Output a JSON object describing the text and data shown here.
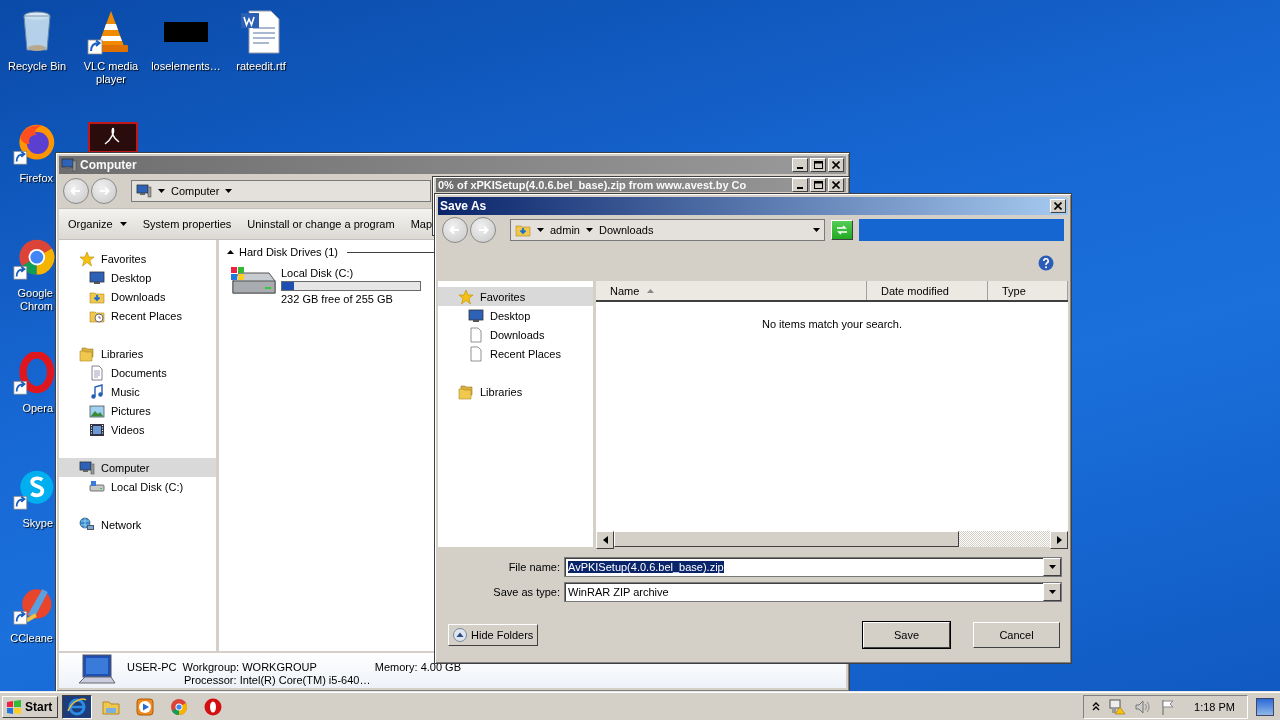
{
  "desktop": {
    "top_icons": [
      {
        "label": "Recycle Bin",
        "kind": "recycle"
      },
      {
        "label": "VLC media player",
        "kind": "vlc"
      },
      {
        "label": "loselements…",
        "kind": "thumbnail"
      },
      {
        "label": "rateedit.rtf",
        "kind": "word"
      }
    ],
    "side_icons": [
      {
        "label": "Firefox",
        "kind": "firefox"
      },
      {
        "label": "Google Chrom",
        "kind": "chrome"
      },
      {
        "label": "Opera",
        "kind": "opera"
      },
      {
        "label": "Skype",
        "kind": "skype"
      },
      {
        "label": "CCleane",
        "kind": "ccleaner"
      }
    ]
  },
  "computer_window": {
    "title": "Computer",
    "address": "Computer",
    "toolbar": [
      {
        "label": "Organize",
        "kind": "menu"
      },
      {
        "label": "System properties",
        "kind": "command"
      },
      {
        "label": "Uninstall or change a program",
        "kind": "command"
      },
      {
        "label": "Map",
        "kind": "command"
      }
    ],
    "nav": [
      {
        "label": "Favorites",
        "kind": "star",
        "selected": false,
        "children": [
          {
            "label": "Desktop",
            "kind": "monitor",
            "selected": false
          },
          {
            "label": "Downloads",
            "kind": "download-folder",
            "selected": false
          },
          {
            "label": "Recent Places",
            "kind": "clock-folder",
            "selected": false
          }
        ]
      },
      {
        "label": "Libraries",
        "kind": "library",
        "selected": false,
        "children": [
          {
            "label": "Documents",
            "kind": "document",
            "selected": false
          },
          {
            "label": "Music",
            "kind": "music",
            "selected": false
          },
          {
            "label": "Pictures",
            "kind": "picture",
            "selected": false
          },
          {
            "label": "Videos",
            "kind": "film",
            "selected": false
          }
        ]
      },
      {
        "label": "Computer",
        "kind": "computer",
        "selected": true,
        "children": [
          {
            "label": "Local Disk (C:)",
            "kind": "drive",
            "selected": false
          }
        ]
      },
      {
        "label": "Network",
        "kind": "network",
        "selected": false
      }
    ],
    "group": "Hard Disk Drives (1)",
    "drives": [
      {
        "name": "Local Disk (C:)",
        "level": 0.09,
        "space": "232 GB free of 255 GB"
      }
    ],
    "details": {
      "name": "USER-PC",
      "workgroup": "Workgroup: WORKGROUP",
      "memory": "Memory: 4.00 GB",
      "processor": "Processor: Intel(R) Core(TM) i5-640…"
    }
  },
  "download_window": {
    "title": "0% of xPKISetup(4.0.6.bel_base).zip from www.avest.by Co"
  },
  "save_dialog": {
    "title": "Save As",
    "path": [
      "admin",
      "Downloads"
    ],
    "nav": [
      {
        "label": "Favorites",
        "kind": "star",
        "selected": true,
        "children": [
          {
            "label": "Desktop",
            "kind": "monitor",
            "selected": false
          },
          {
            "label": "Downloads",
            "kind": "page",
            "selected": false
          },
          {
            "label": "Recent Places",
            "kind": "page",
            "selected": false
          }
        ]
      },
      {
        "label": "Libraries",
        "kind": "library",
        "selected": false
      }
    ],
    "columns": [
      {
        "label": "Name",
        "sorted": true
      },
      {
        "label": "Date modified",
        "sorted": false
      },
      {
        "label": "Type",
        "sorted": false
      }
    ],
    "empty_message": "No items match your search.",
    "fields": [
      {
        "label": "File name:",
        "value": "AvPKISetup(4.0.6.bel_base).zip",
        "selected": true
      },
      {
        "label": "Save as type:",
        "value": "WinRAR ZIP archive",
        "selected": false
      }
    ],
    "hide_folders": "Hide Folders",
    "buttons": [
      {
        "label": "Save",
        "default": true
      },
      {
        "label": "Cancel",
        "default": false
      }
    ]
  },
  "taskbar": {
    "start": "Start",
    "apps": [
      {
        "kind": "ie",
        "selected": true
      },
      {
        "kind": "explorer",
        "selected": false
      },
      {
        "kind": "media",
        "selected": false
      },
      {
        "kind": "chrome",
        "selected": false
      },
      {
        "kind": "opera",
        "selected": false
      }
    ],
    "clock": "1:18 PM"
  }
}
